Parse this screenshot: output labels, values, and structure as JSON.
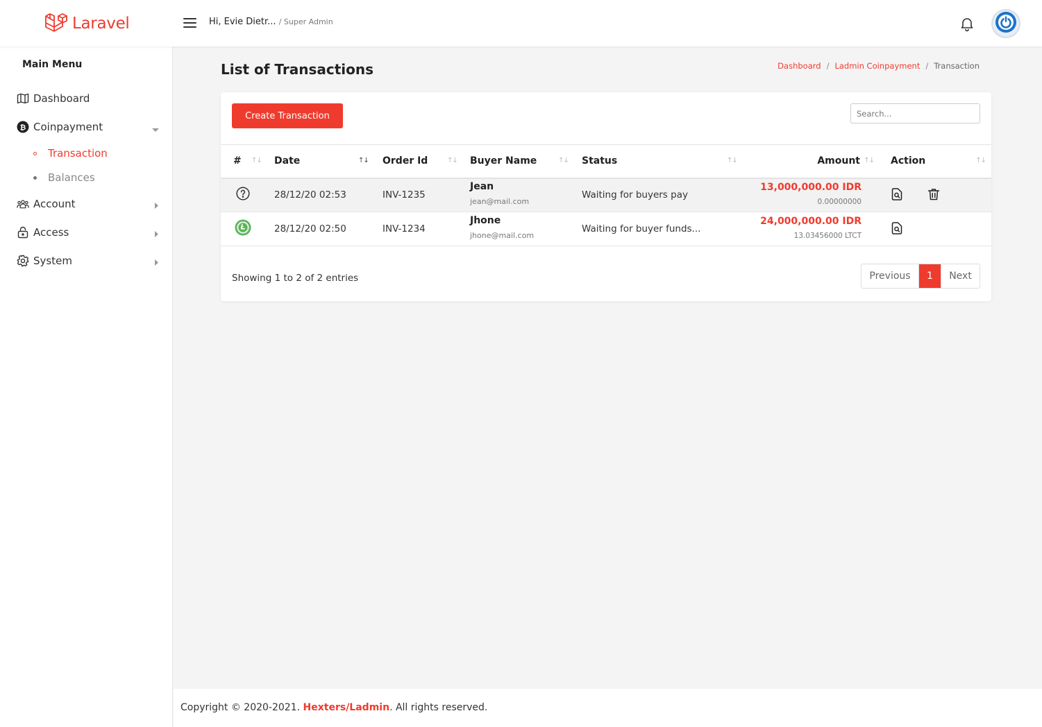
{
  "header": {
    "brand": "Laravel",
    "greeting": "Hi, Evie Dietr...",
    "role": "/ Super Admin",
    "icons": {
      "menu": "hamburger-icon",
      "notifications": "bell-icon",
      "user": "power-icon"
    }
  },
  "sidebar": {
    "title": "Main Menu",
    "items": [
      {
        "label": "Dashboard",
        "icon": "map-icon"
      },
      {
        "label": "Coinpayment",
        "icon": "bitcoin-icon",
        "expanded": true
      },
      {
        "label": "Account",
        "icon": "users-icon"
      },
      {
        "label": "Access",
        "icon": "lock-icon"
      },
      {
        "label": "System",
        "icon": "gear-icon"
      }
    ],
    "subitems": [
      {
        "label": "Transaction",
        "active": true
      },
      {
        "label": "Balances",
        "active": false
      }
    ]
  },
  "page": {
    "title": "List of Transactions",
    "breadcrumb": [
      "Dashboard",
      "Ladmin Coinpayment",
      "Transaction"
    ],
    "separator": "/"
  },
  "toolbar": {
    "create_label": "Create Transaction",
    "search_placeholder": "Search..."
  },
  "table": {
    "columns": [
      "#",
      "Date",
      "Order Id",
      "Buyer Name",
      "Status",
      "Amount",
      "Action"
    ],
    "rows": [
      {
        "coin_icon": "question-circle-icon",
        "date": "28/12/20 02:53",
        "order_id": "INV-1235",
        "buyer_name": "Jean",
        "buyer_email": "jean@mail.com",
        "status": "Waiting for buyers pay",
        "amount": "13,000,000.00 IDR",
        "amount_crypto": "0.00000000",
        "actions": [
          "view",
          "delete"
        ]
      },
      {
        "coin_icon": "litecoin-icon",
        "date": "28/12/20 02:50",
        "order_id": "INV-1234",
        "buyer_name": "Jhone",
        "buyer_email": "jhone@mail.com",
        "status": "Waiting for buyer funds...",
        "amount": "24,000,000.00 IDR",
        "amount_crypto": "13.03456000 LTCT",
        "actions": [
          "view"
        ]
      }
    ]
  },
  "footer_info": {
    "showing": "Showing 1 to 2 of 2 entries",
    "pagination": {
      "previous": "Previous",
      "current": "1",
      "next": "Next"
    }
  },
  "footer": {
    "prefix": "Copyright © 2020-2021.",
    "brand": "Hexters/Ladmin",
    "suffix": ". All rights reserved."
  },
  "colors": {
    "accent": "#ef3b2d",
    "litecoin": "#5bb35b",
    "avatar": "#1a73c8"
  }
}
